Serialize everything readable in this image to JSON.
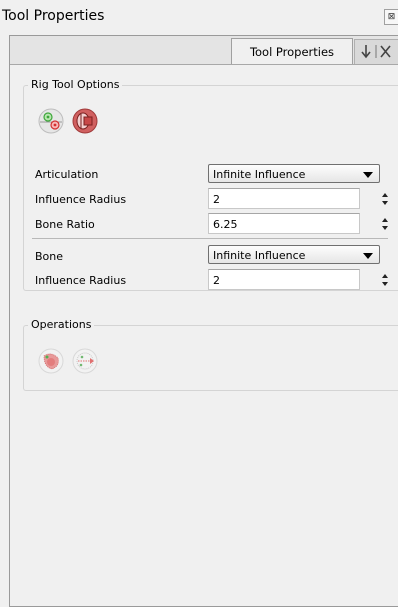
{
  "window": {
    "title": "Tool Properties",
    "close_glyph": "⊠"
  },
  "tab": {
    "label": "Tool Properties"
  },
  "rig_tool_options": {
    "group_label": "Rig Tool Options",
    "articulation": {
      "label": "Articulation",
      "value": "Infinite Influence"
    },
    "articulation_radius": {
      "label": "Influence Radius",
      "value": "2"
    },
    "bone_ratio": {
      "label": "Bone Ratio",
      "value": "6.25"
    },
    "bone": {
      "label": "Bone",
      "value": "Infinite Influence"
    },
    "bone_radius": {
      "label": "Influence Radius",
      "value": "2"
    }
  },
  "operations": {
    "group_label": "Operations"
  },
  "icons": {
    "rig_tool_1": "rig-tool-green-icon",
    "rig_tool_2": "rig-tool-red-bone-icon",
    "op_1": "red-cluster-operation-icon",
    "op_2": "bone-arrow-operation-icon"
  }
}
